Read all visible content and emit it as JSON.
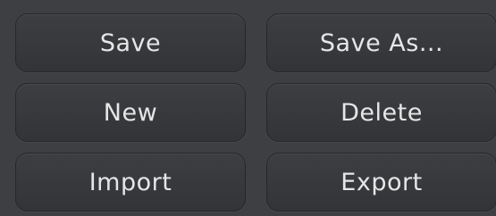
{
  "buttons": {
    "save": "Save",
    "save_as": "Save As...",
    "new": "New",
    "delete": "Delete",
    "import": "Import",
    "export": "Export"
  }
}
